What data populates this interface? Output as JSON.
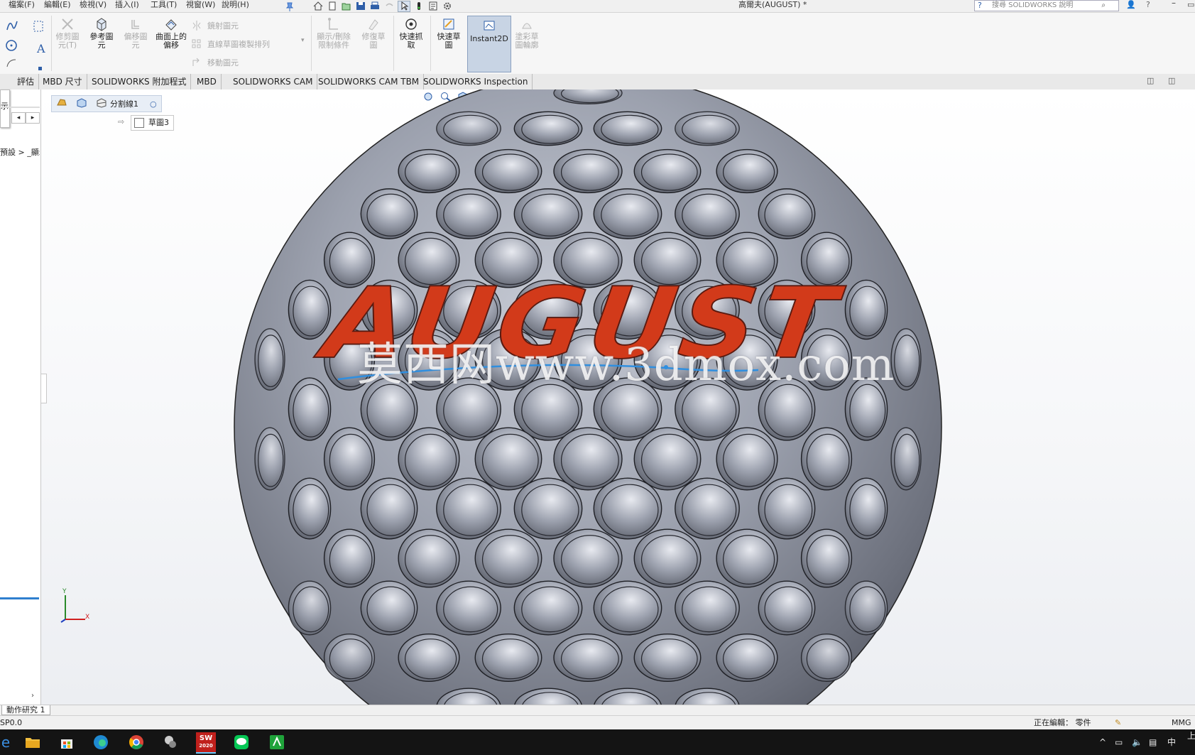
{
  "menubar": {
    "items": [
      "檔案(F)",
      "編輯(E)",
      "檢視(V)",
      "插入(I)",
      "工具(T)",
      "視窗(W)",
      "說明(H)"
    ],
    "document_title": "高爾夫(AUGUST) *",
    "search_placeholder": "搜尋 SOLIDWORKS 說明"
  },
  "command_manager": {
    "trim": "修剪圖元(T)",
    "convert": "參考圖元",
    "offset": "偏移圖元",
    "offset_on_surface": "曲面上的偏移",
    "mirror": "鏡射圖元",
    "linear_pattern": "直線草圖複製排列",
    "move": "移動圖元",
    "display_relations": "顯示/刪除限制條件",
    "repair": "修復草圖",
    "quick_snaps": "快速抓取",
    "rapid_sketch": "快速草圖",
    "instant2d": "Instant2D",
    "shaded_sketch": "塗彩草圖輪廓"
  },
  "tabs": [
    "評估",
    "MBD 尺寸",
    "SOLIDWORKS 附加程式",
    "MBD",
    "SOLIDWORKS CAM",
    "SOLIDWORKS CAM TBM",
    "SOLIDWORKS Inspection"
  ],
  "left_panel": {
    "stub_label": "示",
    "config_text": "預設 > _顯示"
  },
  "breadcrumb": {
    "feature": "分割線1",
    "sketch": "草圖3"
  },
  "model": {
    "text": "AUGUST",
    "text_color": "#d23a1a",
    "body_color": "#8f939f"
  },
  "watermark": "莫西网www.3dmox.com",
  "triad": {
    "x": "X",
    "y": "Y"
  },
  "motion_tab": "動作研究 1",
  "statusbar": {
    "left": "SP0.0",
    "editing": "正在編輯： 零件",
    "units": "MMG"
  },
  "taskbar": {
    "apps": [
      "file-explorer",
      "store",
      "edge",
      "chrome",
      "app-5",
      "solidworks",
      "line",
      "app-8"
    ],
    "sw_label": "2020",
    "ime": "中",
    "clock": "上"
  }
}
